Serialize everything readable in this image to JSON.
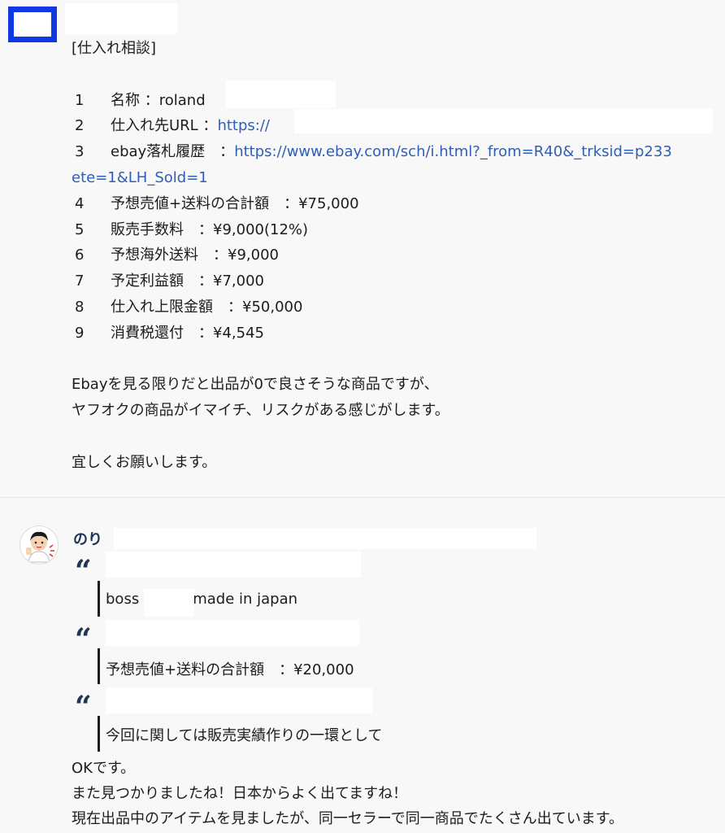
{
  "post1": {
    "title": "[仕入れ相談]",
    "items": [
      {
        "num": "1",
        "label": "名称 ：",
        "value": " roland"
      },
      {
        "num": "2",
        "label": "仕入れ先URL ：",
        "link": "https://"
      },
      {
        "num": "3",
        "label": "ebay落札履歴　：",
        "link": "https://www.ebay.com/sch/i.html?_from=R40&_trksid=p233"
      },
      {
        "num": "4",
        "label": "予想売値+送料の合計額　：",
        "value": "¥75,000"
      },
      {
        "num": "5",
        "label": "販売手数料　：",
        "value": "¥9,000(12%)"
      },
      {
        "num": "6",
        "label": "予想海外送料　：",
        "value": "¥9,000"
      },
      {
        "num": "7",
        "label": "予定利益額　：",
        "value": " ¥7,000"
      },
      {
        "num": "8",
        "label": "仕入れ上限金額　：",
        "value": "¥50,000"
      },
      {
        "num": "9",
        "label": "消費税還付　：",
        "value": "¥4,545"
      }
    ],
    "link_continuation": "ete=1&LH_Sold=1",
    "body_lines": [
      "Ebayを見る限りだと出品が0で良さそうな商品ですが、",
      "ヤフオクの商品がイマイチ、リスクがある感じがします。"
    ],
    "closing": "宜しくお願いします。"
  },
  "post2": {
    "sender": "のり",
    "quotes": [
      {
        "text_a": "boss",
        "text_b": "made in japan"
      },
      {
        "text": "予想売値+送料の合計額　：¥20,000"
      },
      {
        "text": "今回に関しては販売実績作りの一環として"
      }
    ],
    "reply_lines": [
      "OKです。",
      "また見つかりましたね！日本からよく出てますね！",
      "現在出品中のアイテムを見ましたが、同一セラーで同一商品でたくさん出ています。"
    ]
  },
  "colors": {
    "accent_blue": "#1238e6",
    "link": "#2f5fb5",
    "quote": "#1d3557"
  }
}
